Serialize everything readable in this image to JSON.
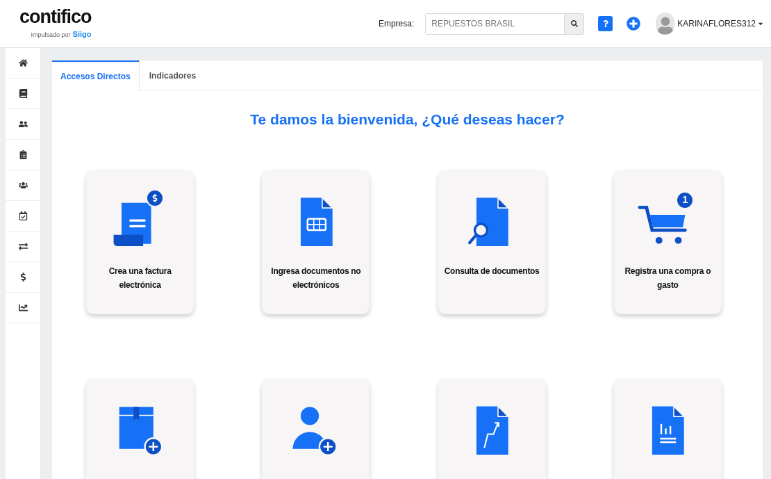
{
  "logo": {
    "name": "contifico",
    "tagline": "Impulsado por",
    "partner": "Siigo"
  },
  "header": {
    "company_label": "Empresa:",
    "company_value": "REPUESTOS BRASIL",
    "user": "KARINAFLORES312"
  },
  "tabs": [
    {
      "label": "Accesos Directos",
      "selected": true
    },
    {
      "label": "Indicadores",
      "selected": false
    }
  ],
  "heading": "Te damos la bienvenida, ¿Qué deseas hacer?",
  "cards": [
    {
      "kind": "invoice",
      "label": "Crea una factura electrónica"
    },
    {
      "kind": "sheet",
      "label": "Ingresa documentos no electrónicos"
    },
    {
      "kind": "search",
      "label": "Consulta de documentos"
    },
    {
      "kind": "cart",
      "label": "Registra una compra o gasto",
      "badge": "1"
    },
    {
      "kind": "box"
    },
    {
      "kind": "person"
    },
    {
      "kind": "trend"
    },
    {
      "kind": "bars"
    }
  ]
}
